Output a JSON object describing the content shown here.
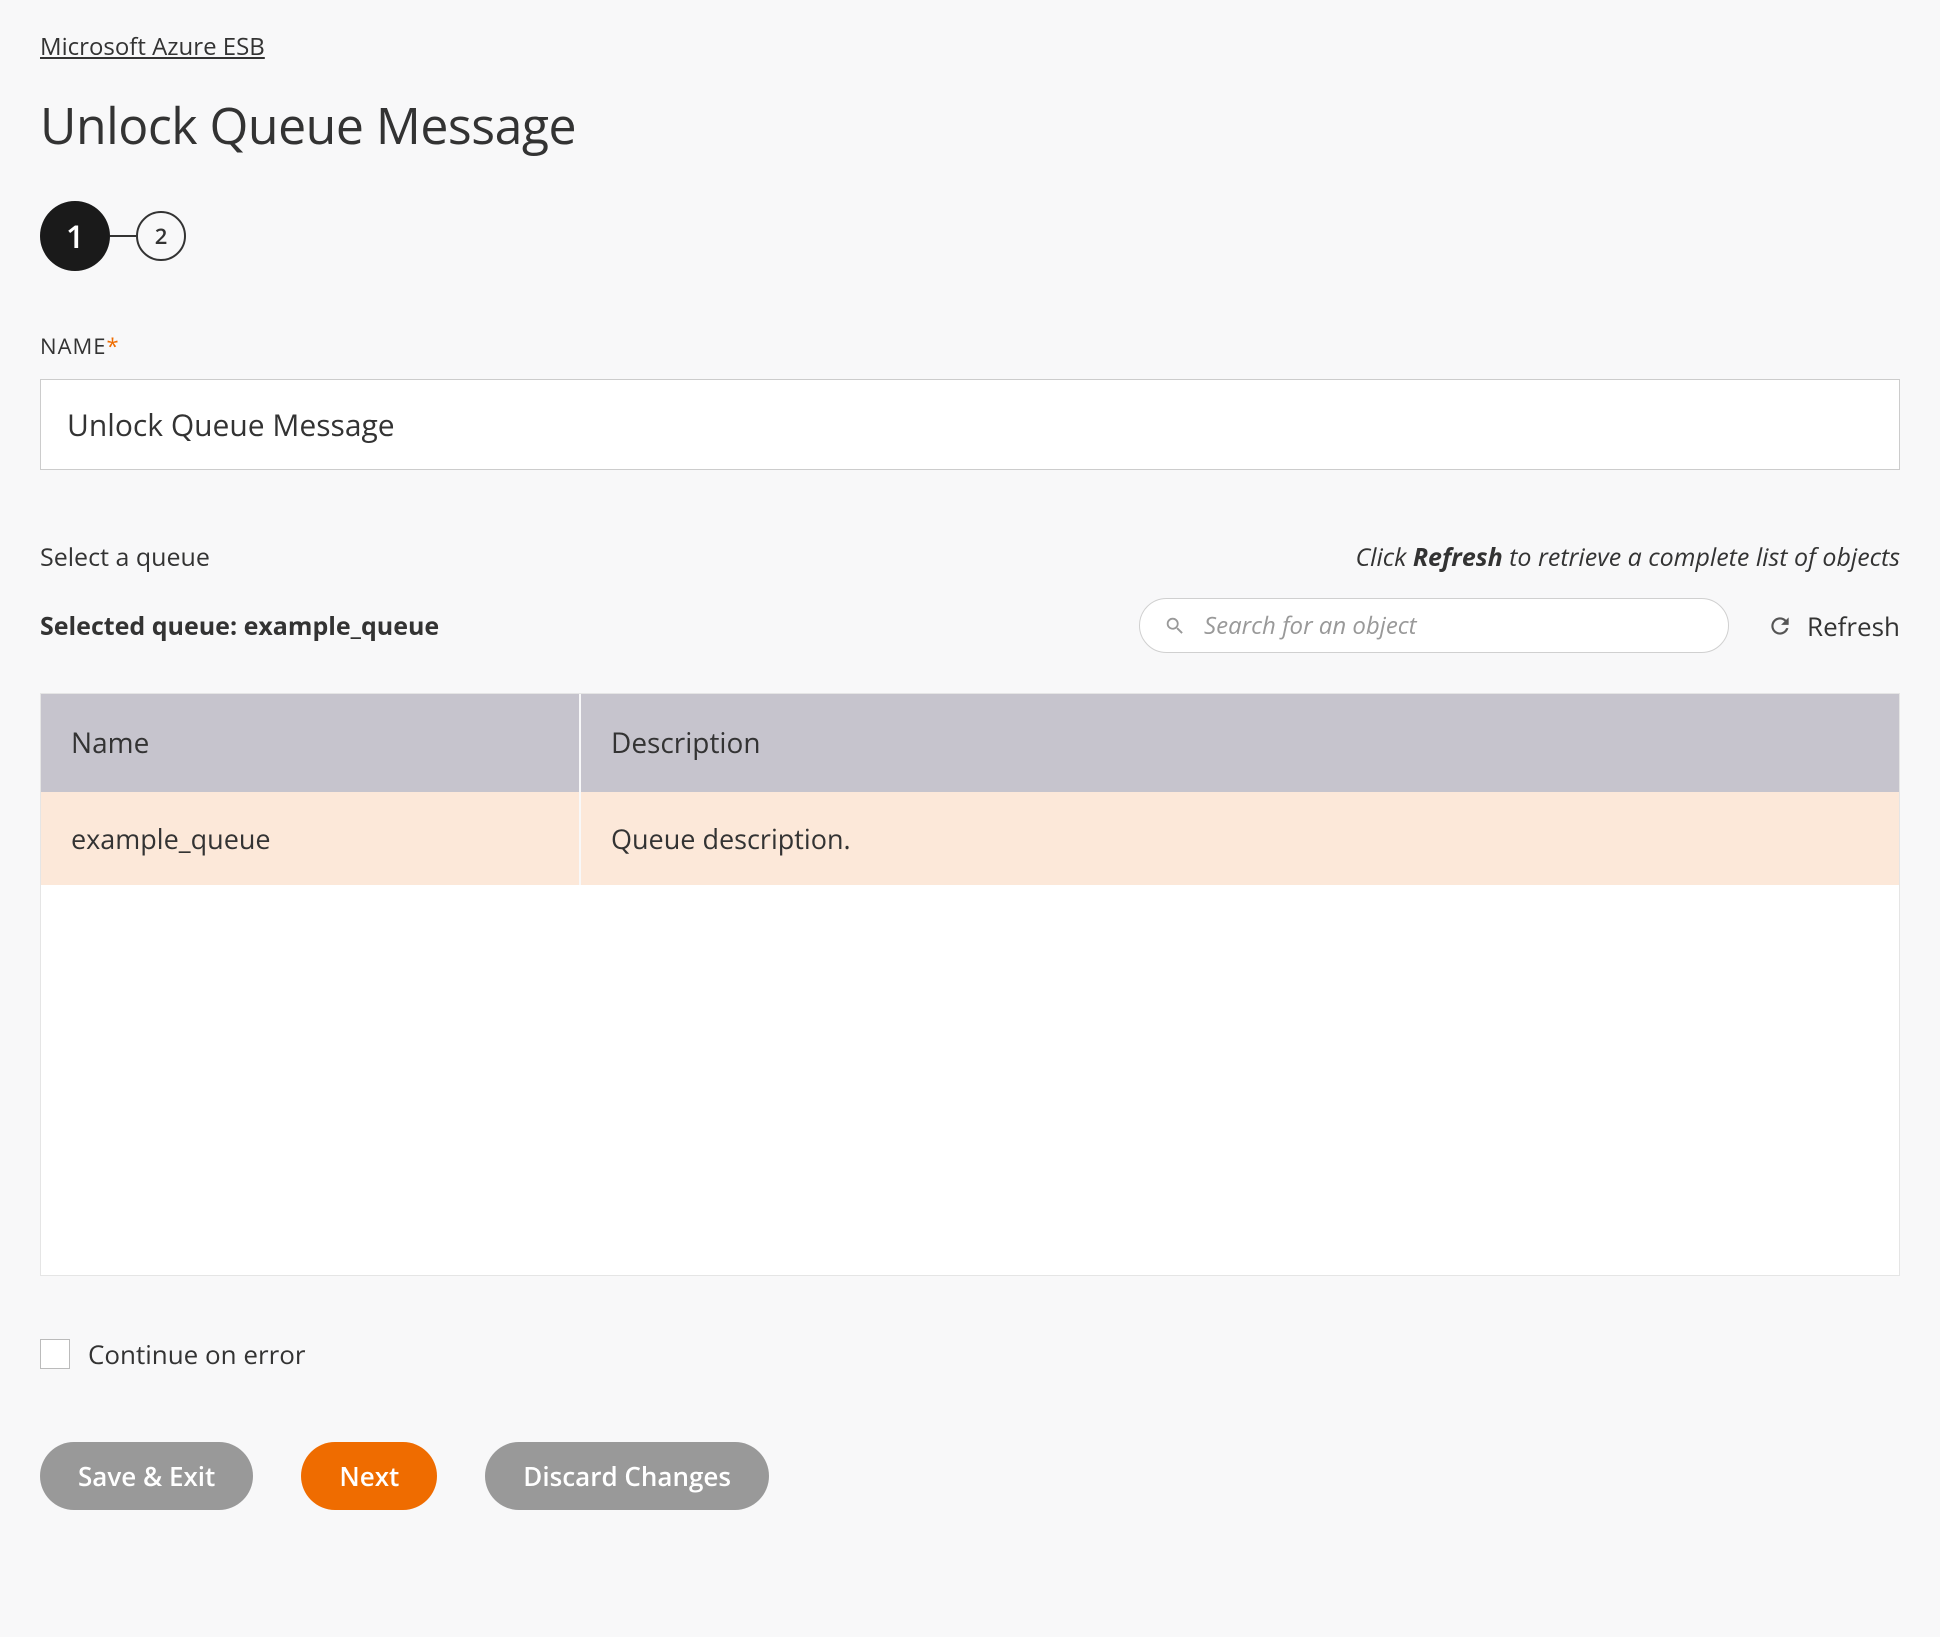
{
  "breadcrumb": "Microsoft Azure ESB",
  "page_title": "Unlock Queue Message",
  "stepper": {
    "current": 1,
    "steps": [
      "1",
      "2"
    ]
  },
  "name_field": {
    "label": "NAME",
    "required_mark": "*",
    "value": "Unlock Queue Message"
  },
  "queue_select": {
    "select_label": "Select a queue",
    "hint_prefix": "Click ",
    "hint_strong": "Refresh",
    "hint_suffix": " to retrieve a complete list of objects",
    "selected_prefix": "Selected queue: ",
    "selected_value": "example_queue",
    "search_placeholder": "Search for an object",
    "refresh_label": "Refresh"
  },
  "table": {
    "headers": {
      "name": "Name",
      "description": "Description"
    },
    "rows": [
      {
        "name": "example_queue",
        "description": "Queue description.",
        "selected": true
      }
    ]
  },
  "continue_on_error": {
    "label": "Continue on error",
    "checked": false
  },
  "buttons": {
    "save_exit": "Save & Exit",
    "next": "Next",
    "discard": "Discard Changes"
  }
}
